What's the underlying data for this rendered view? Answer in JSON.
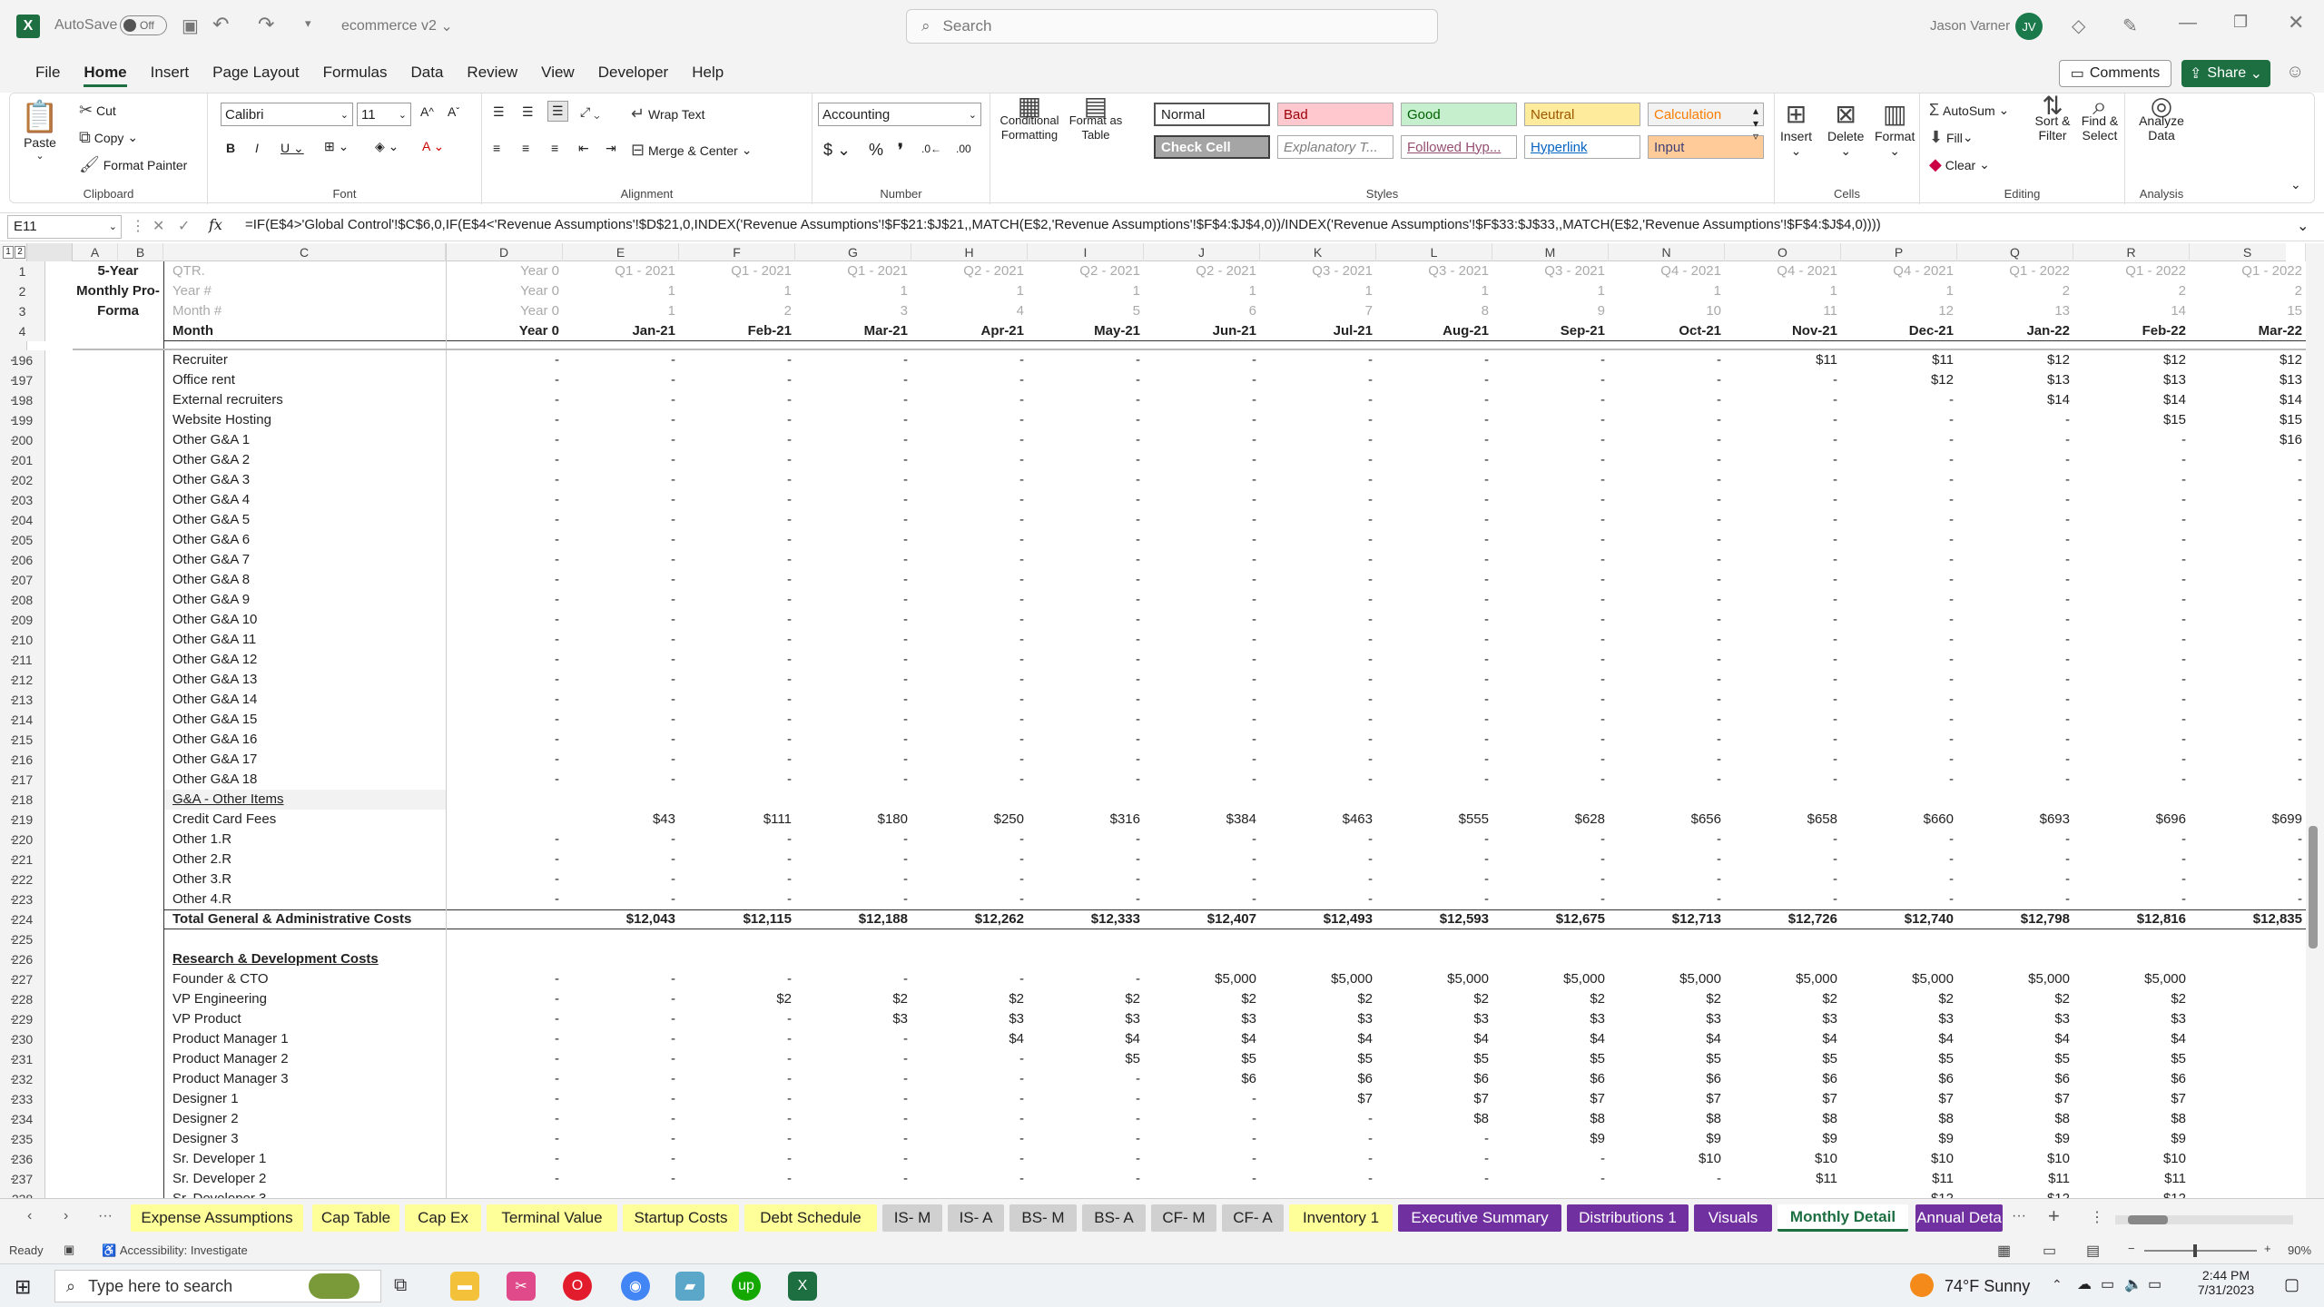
{
  "titlebar": {
    "autosave_label": "AutoSave",
    "autosave_state": "Off",
    "filename": "ecommerce v2",
    "search_placeholder": "Search",
    "user_name": "Jason Varner",
    "user_initials": "JV"
  },
  "menu": [
    "File",
    "Home",
    "Insert",
    "Page Layout",
    "Formulas",
    "Data",
    "Review",
    "View",
    "Developer",
    "Help"
  ],
  "menu_active": "Home",
  "comments_label": "Comments",
  "share_label": "Share",
  "ribbon": {
    "clipboard": {
      "paste": "Paste",
      "cut": "Cut",
      "copy": "Copy",
      "format_painter": "Format Painter",
      "label": "Clipboard"
    },
    "font": {
      "name": "Calibri",
      "size": "11",
      "label": "Font"
    },
    "alignment": {
      "wrap": "Wrap Text",
      "merge": "Merge & Center",
      "label": "Alignment"
    },
    "number": {
      "format": "Accounting",
      "label": "Number"
    },
    "styles": {
      "conditional": "Conditional Formatting",
      "format_table": "Format as Table",
      "cells": [
        {
          "text": "Normal",
          "bg": "#ffffff",
          "color": "#222222"
        },
        {
          "text": "Bad",
          "bg": "#ffc7ce",
          "color": "#9c0006"
        },
        {
          "text": "Good",
          "bg": "#c6efce",
          "color": "#006100"
        },
        {
          "text": "Neutral",
          "bg": "#ffeb9c",
          "color": "#9c5700"
        },
        {
          "text": "Calculation",
          "bg": "#f2f2f2",
          "color": "#fa7d00"
        },
        {
          "text": "Check Cell",
          "bg": "#a5a5a5",
          "color": "#ffffff"
        },
        {
          "text": "Explanatory T...",
          "bg": "#ffffff",
          "color": "#7f7f7f"
        },
        {
          "text": "Followed Hyp...",
          "bg": "#ffffff",
          "color": "#954f72"
        },
        {
          "text": "Hyperlink",
          "bg": "#ffffff",
          "color": "#0563c1"
        },
        {
          "text": "Input",
          "bg": "#ffcc99",
          "color": "#3f3f76"
        }
      ],
      "label": "Styles"
    },
    "cells": {
      "insert": "Insert",
      "delete": "Delete",
      "format": "Format",
      "label": "Cells"
    },
    "editing": {
      "autosum": "AutoSum",
      "fill": "Fill",
      "clear": "Clear",
      "sort": "Sort & Filter",
      "find": "Find & Select",
      "label": "Editing"
    },
    "analysis": {
      "analyze": "Analyze Data",
      "label": "Analysis"
    }
  },
  "formula_bar": {
    "name_box": "E11",
    "formula": "=IF(E$4>'Global Control'!$C$6,0,IF(E$4<'Revenue Assumptions'!$D$21,0,INDEX('Revenue Assumptions'!$F$21:$J$21,,MATCH(E$2,'Revenue Assumptions'!$F$4:$J$4,0))/INDEX('Revenue Assumptions'!$F$33:$J$33,,MATCH(E$2,'Revenue Assumptions'!$F$4:$J$4,0))))"
  },
  "columns": [
    "A",
    "B",
    "C",
    "D",
    "E",
    "F",
    "G",
    "H",
    "I",
    "J",
    "K",
    "L",
    "M",
    "N",
    "O",
    "P",
    "Q",
    "R",
    "S"
  ],
  "header_rows": {
    "a_label": [
      "5-Year",
      "Monthly Pro-",
      "Forma"
    ],
    "c_label": [
      "QTR.",
      "Year #",
      "Month #",
      "Month"
    ],
    "d": [
      "Year 0",
      "Year 0",
      "Year 0",
      "Year 0"
    ],
    "qtr": [
      "Q1 - 2021",
      "Q1 - 2021",
      "Q1 - 2021",
      "Q2 - 2021",
      "Q2 - 2021",
      "Q2 - 2021",
      "Q3 - 2021",
      "Q3 - 2021",
      "Q3 - 2021",
      "Q4 - 2021",
      "Q4 - 2021",
      "Q4 - 2021",
      "Q1 - 2022",
      "Q1 - 2022",
      "Q1 - 2022"
    ],
    "year": [
      "1",
      "1",
      "1",
      "1",
      "1",
      "1",
      "1",
      "1",
      "1",
      "1",
      "1",
      "1",
      "2",
      "2",
      "2"
    ],
    "month_num": [
      "1",
      "2",
      "3",
      "4",
      "5",
      "6",
      "7",
      "8",
      "9",
      "10",
      "11",
      "12",
      "13",
      "14",
      "15"
    ],
    "month": [
      "Jan-21",
      "Feb-21",
      "Mar-21",
      "Apr-21",
      "May-21",
      "Jun-21",
      "Jul-21",
      "Aug-21",
      "Sep-21",
      "Oct-21",
      "Nov-21",
      "Dec-21",
      "Jan-22",
      "Feb-22",
      "Mar-22"
    ]
  },
  "rows": [
    {
      "n": "196",
      "label": "Recruiter",
      "vals": [
        "-",
        "-",
        "-",
        "-",
        "-",
        "-",
        "-",
        "-",
        "-",
        "-",
        "-",
        "$11",
        "$11",
        "$12",
        "$12",
        "$12"
      ]
    },
    {
      "n": "197",
      "label": "Office rent",
      "vals": [
        "-",
        "-",
        "-",
        "-",
        "-",
        "-",
        "-",
        "-",
        "-",
        "-",
        "-",
        "-",
        "$12",
        "$13",
        "$13",
        "$13"
      ]
    },
    {
      "n": "198",
      "label": "External recruiters",
      "vals": [
        "-",
        "-",
        "-",
        "-",
        "-",
        "-",
        "-",
        "-",
        "-",
        "-",
        "-",
        "-",
        "-",
        "$14",
        "$14",
        "$14"
      ]
    },
    {
      "n": "199",
      "label": "Website Hosting",
      "vals": [
        "-",
        "-",
        "-",
        "-",
        "-",
        "-",
        "-",
        "-",
        "-",
        "-",
        "-",
        "-",
        "-",
        "-",
        "$15",
        "$15"
      ]
    },
    {
      "n": "200",
      "label": "Other G&A 1",
      "vals": [
        "-",
        "-",
        "-",
        "-",
        "-",
        "-",
        "-",
        "-",
        "-",
        "-",
        "-",
        "-",
        "-",
        "-",
        "-",
        "$16"
      ]
    },
    {
      "n": "201",
      "label": "Other G&A 2",
      "vals": [
        "-",
        "-",
        "-",
        "-",
        "-",
        "-",
        "-",
        "-",
        "-",
        "-",
        "-",
        "-",
        "-",
        "-",
        "-",
        "-"
      ]
    },
    {
      "n": "202",
      "label": "Other G&A 3",
      "vals": [
        "-",
        "-",
        "-",
        "-",
        "-",
        "-",
        "-",
        "-",
        "-",
        "-",
        "-",
        "-",
        "-",
        "-",
        "-",
        "-"
      ]
    },
    {
      "n": "203",
      "label": "Other G&A 4",
      "vals": [
        "-",
        "-",
        "-",
        "-",
        "-",
        "-",
        "-",
        "-",
        "-",
        "-",
        "-",
        "-",
        "-",
        "-",
        "-",
        "-"
      ]
    },
    {
      "n": "204",
      "label": "Other G&A 5",
      "vals": [
        "-",
        "-",
        "-",
        "-",
        "-",
        "-",
        "-",
        "-",
        "-",
        "-",
        "-",
        "-",
        "-",
        "-",
        "-",
        "-"
      ]
    },
    {
      "n": "205",
      "label": "Other G&A 6",
      "vals": [
        "-",
        "-",
        "-",
        "-",
        "-",
        "-",
        "-",
        "-",
        "-",
        "-",
        "-",
        "-",
        "-",
        "-",
        "-",
        "-"
      ]
    },
    {
      "n": "206",
      "label": "Other G&A 7",
      "vals": [
        "-",
        "-",
        "-",
        "-",
        "-",
        "-",
        "-",
        "-",
        "-",
        "-",
        "-",
        "-",
        "-",
        "-",
        "-",
        "-"
      ]
    },
    {
      "n": "207",
      "label": "Other G&A 8",
      "vals": [
        "-",
        "-",
        "-",
        "-",
        "-",
        "-",
        "-",
        "-",
        "-",
        "-",
        "-",
        "-",
        "-",
        "-",
        "-",
        "-"
      ]
    },
    {
      "n": "208",
      "label": "Other G&A 9",
      "vals": [
        "-",
        "-",
        "-",
        "-",
        "-",
        "-",
        "-",
        "-",
        "-",
        "-",
        "-",
        "-",
        "-",
        "-",
        "-",
        "-"
      ]
    },
    {
      "n": "209",
      "label": "Other G&A 10",
      "vals": [
        "-",
        "-",
        "-",
        "-",
        "-",
        "-",
        "-",
        "-",
        "-",
        "-",
        "-",
        "-",
        "-",
        "-",
        "-",
        "-"
      ]
    },
    {
      "n": "210",
      "label": "Other G&A 11",
      "vals": [
        "-",
        "-",
        "-",
        "-",
        "-",
        "-",
        "-",
        "-",
        "-",
        "-",
        "-",
        "-",
        "-",
        "-",
        "-",
        "-"
      ]
    },
    {
      "n": "211",
      "label": "Other G&A 12",
      "vals": [
        "-",
        "-",
        "-",
        "-",
        "-",
        "-",
        "-",
        "-",
        "-",
        "-",
        "-",
        "-",
        "-",
        "-",
        "-",
        "-"
      ]
    },
    {
      "n": "212",
      "label": "Other G&A 13",
      "vals": [
        "-",
        "-",
        "-",
        "-",
        "-",
        "-",
        "-",
        "-",
        "-",
        "-",
        "-",
        "-",
        "-",
        "-",
        "-",
        "-"
      ]
    },
    {
      "n": "213",
      "label": "Other G&A 14",
      "vals": [
        "-",
        "-",
        "-",
        "-",
        "-",
        "-",
        "-",
        "-",
        "-",
        "-",
        "-",
        "-",
        "-",
        "-",
        "-",
        "-"
      ]
    },
    {
      "n": "214",
      "label": "Other G&A 15",
      "vals": [
        "-",
        "-",
        "-",
        "-",
        "-",
        "-",
        "-",
        "-",
        "-",
        "-",
        "-",
        "-",
        "-",
        "-",
        "-",
        "-"
      ]
    },
    {
      "n": "215",
      "label": "Other G&A 16",
      "vals": [
        "-",
        "-",
        "-",
        "-",
        "-",
        "-",
        "-",
        "-",
        "-",
        "-",
        "-",
        "-",
        "-",
        "-",
        "-",
        "-"
      ]
    },
    {
      "n": "216",
      "label": "Other G&A 17",
      "vals": [
        "-",
        "-",
        "-",
        "-",
        "-",
        "-",
        "-",
        "-",
        "-",
        "-",
        "-",
        "-",
        "-",
        "-",
        "-",
        "-"
      ]
    },
    {
      "n": "217",
      "label": "Other G&A 18",
      "vals": [
        "-",
        "-",
        "-",
        "-",
        "-",
        "-",
        "-",
        "-",
        "-",
        "-",
        "-",
        "-",
        "-",
        "-",
        "-",
        "-"
      ]
    },
    {
      "n": "218",
      "label": "G&A - Other Items",
      "style": "ul",
      "vals": []
    },
    {
      "n": "219",
      "label": "Credit Card Fees",
      "vals": [
        "",
        "$43",
        "$111",
        "$180",
        "$250",
        "$316",
        "$384",
        "$463",
        "$555",
        "$628",
        "$656",
        "$658",
        "$660",
        "$693",
        "$696",
        "$699"
      ]
    },
    {
      "n": "220",
      "label": "Other 1.R",
      "vals": [
        "-",
        "-",
        "-",
        "-",
        "-",
        "-",
        "-",
        "-",
        "-",
        "-",
        "-",
        "-",
        "-",
        "-",
        "-",
        "-"
      ]
    },
    {
      "n": "221",
      "label": "Other 2.R",
      "vals": [
        "-",
        "-",
        "-",
        "-",
        "-",
        "-",
        "-",
        "-",
        "-",
        "-",
        "-",
        "-",
        "-",
        "-",
        "-",
        "-"
      ]
    },
    {
      "n": "222",
      "label": "Other 3.R",
      "vals": [
        "-",
        "-",
        "-",
        "-",
        "-",
        "-",
        "-",
        "-",
        "-",
        "-",
        "-",
        "-",
        "-",
        "-",
        "-",
        "-"
      ]
    },
    {
      "n": "223",
      "label": "Other 4.R",
      "vals": [
        "-",
        "-",
        "-",
        "-",
        "-",
        "-",
        "-",
        "-",
        "-",
        "-",
        "-",
        "-",
        "-",
        "-",
        "-",
        "-"
      ]
    },
    {
      "n": "224",
      "label": "Total General & Administrative Costs",
      "style": "total",
      "vals": [
        "",
        "$12,043",
        "$12,115",
        "$12,188",
        "$12,262",
        "$12,333",
        "$12,407",
        "$12,493",
        "$12,593",
        "$12,675",
        "$12,713",
        "$12,726",
        "$12,740",
        "$12,798",
        "$12,816",
        "$12,835"
      ]
    },
    {
      "n": "225",
      "label": "",
      "vals": []
    },
    {
      "n": "226",
      "label": "Research & Development Costs",
      "style": "ulbold",
      "vals": []
    },
    {
      "n": "227",
      "label": "Founder & CTO",
      "vals": [
        "-",
        "-",
        "-",
        "-",
        "-",
        "-",
        "$5,000",
        "$5,000",
        "$5,000",
        "$5,000",
        "$5,000",
        "$5,000",
        "$5,000",
        "$5,000",
        "$5,000",
        ""
      ]
    },
    {
      "n": "228",
      "label": "VP Engineering",
      "vals": [
        "-",
        "-",
        "$2",
        "$2",
        "$2",
        "$2",
        "$2",
        "$2",
        "$2",
        "$2",
        "$2",
        "$2",
        "$2",
        "$2",
        "$2",
        ""
      ]
    },
    {
      "n": "229",
      "label": "VP Product",
      "vals": [
        "-",
        "-",
        "-",
        "$3",
        "$3",
        "$3",
        "$3",
        "$3",
        "$3",
        "$3",
        "$3",
        "$3",
        "$3",
        "$3",
        "$3",
        ""
      ]
    },
    {
      "n": "230",
      "label": "Product Manager 1",
      "vals": [
        "-",
        "-",
        "-",
        "-",
        "$4",
        "$4",
        "$4",
        "$4",
        "$4",
        "$4",
        "$4",
        "$4",
        "$4",
        "$4",
        "$4",
        ""
      ]
    },
    {
      "n": "231",
      "label": "Product Manager 2",
      "vals": [
        "-",
        "-",
        "-",
        "-",
        "-",
        "$5",
        "$5",
        "$5",
        "$5",
        "$5",
        "$5",
        "$5",
        "$5",
        "$5",
        "$5",
        ""
      ]
    },
    {
      "n": "232",
      "label": "Product Manager 3",
      "vals": [
        "-",
        "-",
        "-",
        "-",
        "-",
        "-",
        "$6",
        "$6",
        "$6",
        "$6",
        "$6",
        "$6",
        "$6",
        "$6",
        "$6",
        ""
      ]
    },
    {
      "n": "233",
      "label": "Designer 1",
      "vals": [
        "-",
        "-",
        "-",
        "-",
        "-",
        "-",
        "-",
        "$7",
        "$7",
        "$7",
        "$7",
        "$7",
        "$7",
        "$7",
        "$7",
        ""
      ]
    },
    {
      "n": "234",
      "label": "Designer 2",
      "vals": [
        "-",
        "-",
        "-",
        "-",
        "-",
        "-",
        "-",
        "-",
        "$8",
        "$8",
        "$8",
        "$8",
        "$8",
        "$8",
        "$8",
        ""
      ]
    },
    {
      "n": "235",
      "label": "Designer 3",
      "vals": [
        "-",
        "-",
        "-",
        "-",
        "-",
        "-",
        "-",
        "-",
        "-",
        "$9",
        "$9",
        "$9",
        "$9",
        "$9",
        "$9",
        ""
      ]
    },
    {
      "n": "236",
      "label": "Sr. Developer 1",
      "vals": [
        "-",
        "-",
        "-",
        "-",
        "-",
        "-",
        "-",
        "-",
        "-",
        "-",
        "$10",
        "$10",
        "$10",
        "$10",
        "$10",
        ""
      ]
    },
    {
      "n": "237",
      "label": "Sr. Developer 2",
      "vals": [
        "-",
        "-",
        "-",
        "-",
        "-",
        "-",
        "-",
        "-",
        "-",
        "-",
        "-",
        "$11",
        "$11",
        "$11",
        "$11",
        ""
      ]
    },
    {
      "n": "238",
      "label": "Sr. Developer 3",
      "vals": [
        "-",
        "-",
        "-",
        "-",
        "-",
        "-",
        "-",
        "-",
        "-",
        "-",
        "-",
        "-",
        "$12",
        "$12",
        "$12",
        ""
      ]
    }
  ],
  "sheet_tabs": [
    {
      "name": "Expense Assumptions",
      "bg": "#ffff99",
      "color": "#222222"
    },
    {
      "name": "Cap Table",
      "bg": "#ffff99",
      "color": "#222222"
    },
    {
      "name": "Cap Ex",
      "bg": "#ffff99",
      "color": "#222222"
    },
    {
      "name": "Terminal Value",
      "bg": "#ffff99",
      "color": "#222222"
    },
    {
      "name": "Startup Costs",
      "bg": "#ffff99",
      "color": "#222222"
    },
    {
      "name": "Debt Schedule",
      "bg": "#ffff99",
      "color": "#222222"
    },
    {
      "name": "IS- M",
      "bg": "#d0d0d0",
      "color": "#222222"
    },
    {
      "name": "IS- A",
      "bg": "#d0d0d0",
      "color": "#222222"
    },
    {
      "name": "BS- M",
      "bg": "#d0d0d0",
      "color": "#222222"
    },
    {
      "name": "BS- A",
      "bg": "#d0d0d0",
      "color": "#222222"
    },
    {
      "name": "CF- M",
      "bg": "#d0d0d0",
      "color": "#222222"
    },
    {
      "name": "CF- A",
      "bg": "#d0d0d0",
      "color": "#222222"
    },
    {
      "name": "Inventory 1",
      "bg": "#ffff99",
      "color": "#222222"
    },
    {
      "name": "Executive Summary",
      "bg": "#7030a0",
      "color": "#ffffff"
    },
    {
      "name": "Distributions 1",
      "bg": "#7030a0",
      "color": "#ffffff"
    },
    {
      "name": "Visuals",
      "bg": "#7030a0",
      "color": "#ffffff"
    },
    {
      "name": "Monthly Detail",
      "bg": "#ffffff",
      "color": "#1d6f42"
    },
    {
      "name": "Annual Deta",
      "bg": "#7030a0",
      "color": "#ffffff"
    }
  ],
  "status": {
    "ready": "Ready",
    "accessibility": "Accessibility: Investigate",
    "zoom": "90%"
  },
  "taskbar": {
    "search_placeholder": "Type here to search",
    "weather": "74°F  Sunny",
    "time": "2:44 PM",
    "date": "7/31/2023"
  }
}
